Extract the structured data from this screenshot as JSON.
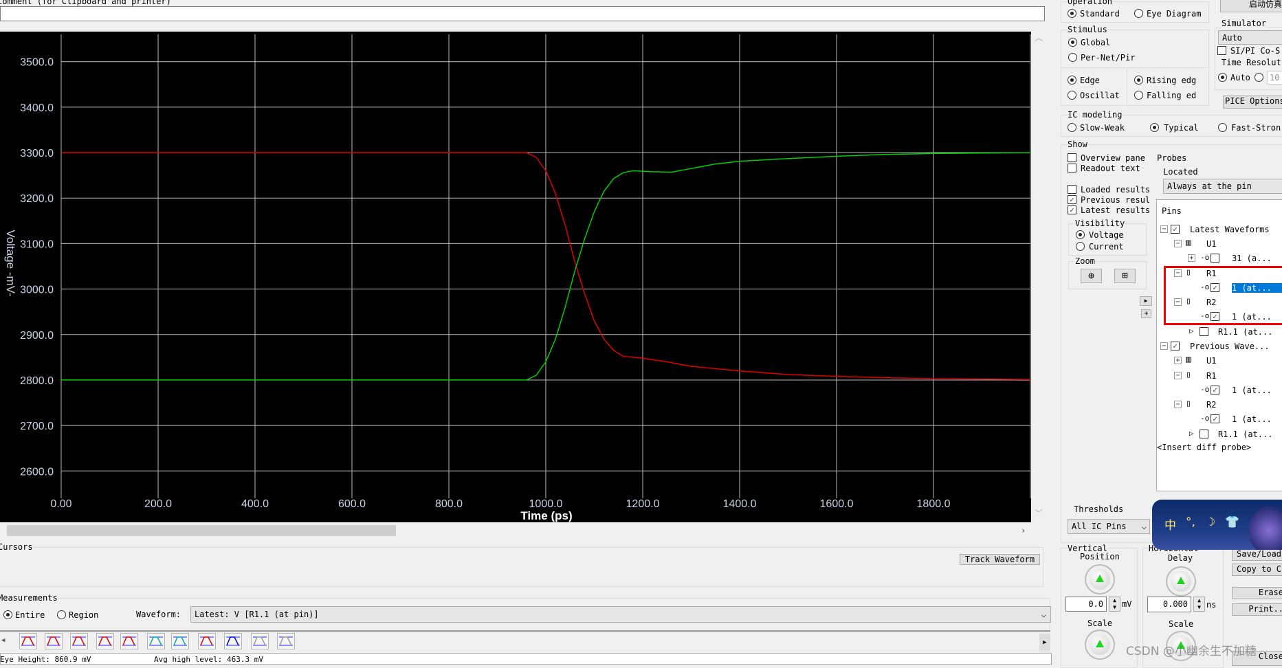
{
  "comment": {
    "label": "Comment (for Clipboard and printer)",
    "value": ""
  },
  "chart_data": {
    "type": "line",
    "xlabel": "Time (ps)",
    "ylabel": "Voltage -mV-",
    "xlim": [
      0,
      2000
    ],
    "ylim": [
      2540,
      3560
    ],
    "xticks": [
      "0.00",
      "200.0",
      "400.0",
      "600.0",
      "800.0",
      "1000.0",
      "1200.0",
      "1400.0",
      "1600.0",
      "1800.0"
    ],
    "xtick_values": [
      0,
      200,
      400,
      600,
      800,
      1000,
      1200,
      1400,
      1600,
      1800
    ],
    "yticks": [
      "3500.0",
      "3400.0",
      "3300.0",
      "3200.0",
      "3100.0",
      "3000.0",
      "2900.0",
      "2800.0",
      "2700.0",
      "2600.0"
    ],
    "ytick_values": [
      3500,
      3400,
      3300,
      3200,
      3100,
      3000,
      2900,
      2800,
      2700,
      2600
    ],
    "grid": true,
    "background": "#000000",
    "series": [
      {
        "color": "#e00000",
        "x": [
          0,
          960,
          980,
          1000,
          1020,
          1040,
          1060,
          1080,
          1100,
          1120,
          1140,
          1160,
          1200,
          1250,
          1300,
          1400,
          1500,
          1600,
          1700,
          1800,
          2000
        ],
        "y": [
          3300,
          3300,
          3290,
          3260,
          3210,
          3140,
          3060,
          2990,
          2930,
          2890,
          2865,
          2852,
          2848,
          2840,
          2830,
          2820,
          2812,
          2808,
          2805,
          2803,
          2801
        ]
      },
      {
        "color": "#00d000",
        "x": [
          0,
          960,
          980,
          1000,
          1020,
          1040,
          1060,
          1080,
          1100,
          1120,
          1140,
          1160,
          1180,
          1220,
          1260,
          1300,
          1350,
          1400,
          1500,
          1600,
          1700,
          1800,
          2000
        ],
        "y": [
          2800,
          2800,
          2810,
          2840,
          2890,
          2960,
          3040,
          3110,
          3170,
          3215,
          3243,
          3256,
          3260,
          3258,
          3257,
          3265,
          3275,
          3281,
          3287,
          3292,
          3296,
          3298,
          3300
        ]
      }
    ]
  },
  "cursors": {
    "label": "Cursors",
    "track": "Track Waveform"
  },
  "measurements": {
    "label": "Measurements",
    "entire": "Entire",
    "region": "Region",
    "waveform_label": "Waveform:",
    "waveform_value": "Latest: V [R1.1 (at pin)]",
    "status1": "Eye Height: 860.9 mV",
    "status2": "Avg high level: 463.3 mV"
  },
  "toolbar_icons": [
    "eye-width",
    "overshoot",
    "undershoot",
    "fall-time",
    "rise-time",
    "pulse-width",
    "period",
    "crossing",
    "jitter",
    "eye-mask",
    "diff-eye"
  ],
  "right": {
    "start_sim": "启动仿真",
    "operation": {
      "label": "Operation",
      "standard": "Standard",
      "eye": "Eye Diagram"
    },
    "stimulus": {
      "label": "Stimulus",
      "global": "Global",
      "pernet": "Per-Net/Pir",
      "edge": "Edge",
      "osc": "Oscillat",
      "rising": "Rising edg",
      "falling": "Falling ed"
    },
    "simulator": {
      "label": "Simulator",
      "value": "Auto",
      "sipi": "SI/PI Co-S",
      "timeres": "Time Resolut",
      "auto": "Auto",
      "custom": "10",
      "options": "PICE Options"
    },
    "ic": {
      "label": "IC modeling",
      "slow": "Slow-Weak",
      "typical": "Typical",
      "fast": "Fast-Stron"
    },
    "show": {
      "label": "Show",
      "overview": "Overview pane",
      "readout": "Readout text",
      "loaded": "Loaded results",
      "previous": "Previous resul",
      "latest": "Latest results"
    },
    "visibility": {
      "label": "Visibility",
      "voltage": "Voltage",
      "current": "Current"
    },
    "zoom": {
      "label": "Zoom"
    },
    "probes": {
      "label": "Probes",
      "located": "Located",
      "located_value": "Always at the pin",
      "pins": "Pins",
      "tree": [
        "Latest Waveforms",
        "U1",
        "31 (a...",
        "R1",
        "1 (at...",
        "R2",
        "1 (at...",
        "R1.1 (at...",
        "Previous Wave...",
        "U1",
        "R1",
        "1 (at...",
        "R2",
        "1 (at...",
        "R1.1 (at..."
      ],
      "insert": "<Insert diff probe>"
    },
    "thresholds": {
      "label": "Thresholds",
      "value": "All IC Pins"
    },
    "vertical": {
      "label1": "Vertical",
      "label2": "Position",
      "value": "0.0",
      "unit": "mV",
      "scale": "Scale"
    },
    "horizontal": {
      "label1": "Horizontal",
      "label2": "Delay",
      "value": "0.000",
      "unit": "ns",
      "scale": "Scale"
    },
    "buttons": {
      "save": "Save/Load",
      "copy": "Copy to C",
      "erase": "Erase",
      "print": "Print..",
      "close": "Close"
    }
  },
  "ime": {
    "chars": [
      "中",
      "°,",
      "☽",
      "👕",
      "★"
    ]
  },
  "watermark": "CSDN @小幽余生不加糖"
}
